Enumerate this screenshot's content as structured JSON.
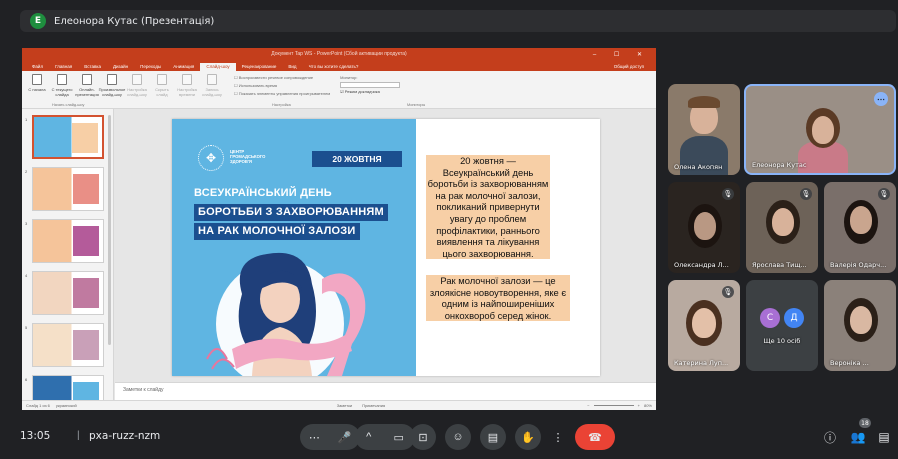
{
  "meeting": {
    "presenter_initial": "Е",
    "presenter_label": "Елеонора Кутас (Презентація)",
    "time": "13:05",
    "separator": "|",
    "code": "pxa-ruzz-nzm",
    "participants_count": "18",
    "others_label": "Ще 10 осіб"
  },
  "ppt": {
    "window_title": "Документ Tap WS - PowerPoint (Сбой активации продукта)",
    "window_controls": "–  ☐  ✕",
    "tabs": [
      "Файл",
      "Главная",
      "Вставка",
      "Дизайн",
      "Переходы",
      "Анимация",
      "Слайд-шоу",
      "Рецензирование",
      "Вид",
      "Что вы хотите сделать?"
    ],
    "active_tab_index": 6,
    "share": "Общий доступ",
    "ribbon_buttons": [
      {
        "label": "С начала",
        "dim": false
      },
      {
        "label": "С текущего слайда",
        "dim": false
      },
      {
        "label": "Онлайн-презентация",
        "dim": false
      },
      {
        "label": "Произвольное слайд-шоу",
        "dim": false
      },
      {
        "label": "Настройка слайд-шоу",
        "dim": true
      },
      {
        "label": "Скрыть слайд",
        "dim": true
      },
      {
        "label": "Настройка времени",
        "dim": true
      },
      {
        "label": "Запись слайд-шоу",
        "dim": true
      }
    ],
    "ribbon_checks": [
      "Воспроизвести речевое сопровождение",
      "Использовать время",
      "Показать элементы управления проигрывателем"
    ],
    "monitor_label": "Монитор:",
    "presenter_view": "Режим докладчика",
    "group_start": "Начать слайд-шоу",
    "group_setup": "Настройка",
    "group_monitors": "Мониторы",
    "thumb_numbers": [
      "1",
      "2",
      "3",
      "4",
      "5",
      "6"
    ],
    "notes_placeholder": "Заметки к слайду",
    "status_left": "Слайд 1 из 6",
    "status_lang": "украинский",
    "status_notes": "Заметки",
    "status_comments": "Примечания",
    "zoom": "80%"
  },
  "slide": {
    "logo_text": "ЦЕНТР ГРОМАДСЬКОГО ЗДОРОВ'Я",
    "date": "20 ЖОВТНЯ",
    "title_lines": [
      "ВСЕУКРАЇНСЬКИЙ ДЕНЬ",
      "БОРОТЬБИ З ЗАХВОРЮВАННЯМ",
      "НА РАК МОЛОЧНОЇ ЗАЛОЗИ"
    ],
    "text1": "20 жовтня — Всеукраїнський день боротьби із захворюванням на рак молочної залози, покликаний привернути увагу до проблем профілактики, раннього виявлення та лікування цього захворювання.",
    "text2": "Рак молочної залози — це злоякісне новоутворення, яке є одним із найпоширеніших онкохвороб серед жінок."
  },
  "participants": [
    {
      "name": "Олена Акопян"
    },
    {
      "name": "Елеонора Кутас"
    },
    {
      "name": "Олександра Л..."
    },
    {
      "name": "Ярослава Тищ..."
    },
    {
      "name": "Валерія Одарч..."
    },
    {
      "name": "Катерина Луп..."
    },
    {
      "name": "Вероніка ..."
    }
  ],
  "others_avatars": [
    {
      "letter": "С",
      "color": "#a86fd4"
    },
    {
      "letter": "Д",
      "color": "#4285f4"
    }
  ],
  "controls": {
    "more_dots": "⋯",
    "mic": "🎤",
    "chevron": "^",
    "camera": "▭",
    "present": "⊡",
    "emoji": "☺",
    "captions": "▤",
    "hand": "✋",
    "more": "⋮",
    "hangup": "☎",
    "info": "ⓘ",
    "people": "👥",
    "chat": "▤"
  },
  "colors": {
    "meet_bg": "#202124",
    "ppt_accent": "#c43e1c",
    "slide_blue": "#5fb5e2",
    "slide_navy": "#1b4f8f",
    "text_box": "#f7cfa6",
    "hangup": "#ea4335"
  }
}
